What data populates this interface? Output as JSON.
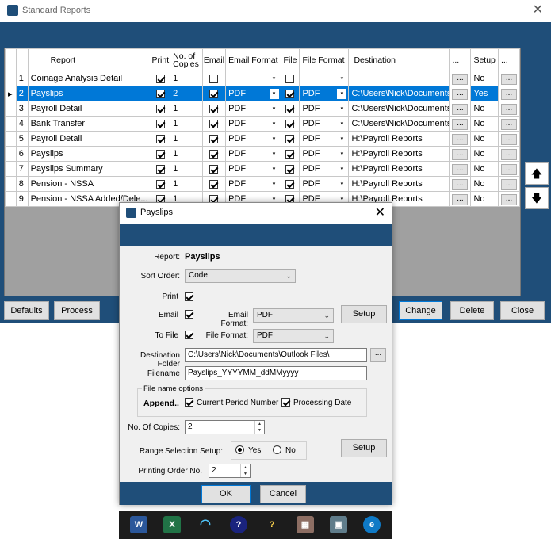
{
  "window": {
    "title": "Standard Reports",
    "close": "✕"
  },
  "grid": {
    "headers": {
      "report": "Report",
      "print": "Print",
      "copies": "No. of Copies",
      "email": "Email",
      "email_format": "Email Format",
      "file": "File",
      "file_format": "File Format",
      "destination": "Destination",
      "dots": "...",
      "setup": "Setup",
      "dots2": "..."
    },
    "rows": [
      {
        "n": "1",
        "report": "Coinage Analysis Detail",
        "print": true,
        "copies": "1",
        "email": false,
        "email_format": "",
        "file": false,
        "file_format": "",
        "destination": "",
        "setup": "No"
      },
      {
        "n": "2",
        "report": "Payslips",
        "print": true,
        "copies": "2",
        "email": true,
        "email_format": "PDF",
        "file": true,
        "file_format": "PDF",
        "destination": "C:\\Users\\Nick\\Documents\\...",
        "setup": "Yes"
      },
      {
        "n": "3",
        "report": "Payroll Detail",
        "print": true,
        "copies": "1",
        "email": true,
        "email_format": "PDF",
        "file": true,
        "file_format": "PDF",
        "destination": "C:\\Users\\Nick\\Documents\\...",
        "setup": "No"
      },
      {
        "n": "4",
        "report": "Bank Transfer",
        "print": true,
        "copies": "1",
        "email": true,
        "email_format": "PDF",
        "file": true,
        "file_format": "PDF",
        "destination": "C:\\Users\\Nick\\Documents\\...",
        "setup": "No"
      },
      {
        "n": "5",
        "report": "Payroll Detail",
        "print": true,
        "copies": "1",
        "email": true,
        "email_format": "PDF",
        "file": true,
        "file_format": "PDF",
        "destination": "H:\\Payroll Reports",
        "setup": "No"
      },
      {
        "n": "6",
        "report": "Payslips",
        "print": true,
        "copies": "1",
        "email": true,
        "email_format": "PDF",
        "file": true,
        "file_format": "PDF",
        "destination": "H:\\Payroll Reports",
        "setup": "No"
      },
      {
        "n": "7",
        "report": "Payslips Summary",
        "print": true,
        "copies": "1",
        "email": true,
        "email_format": "PDF",
        "file": true,
        "file_format": "PDF",
        "destination": "H:\\Payroll Reports",
        "setup": "No"
      },
      {
        "n": "8",
        "report": "Pension - NSSA",
        "print": true,
        "copies": "1",
        "email": true,
        "email_format": "PDF",
        "file": true,
        "file_format": "PDF",
        "destination": "H:\\Payroll Reports",
        "setup": "No"
      },
      {
        "n": "9",
        "report": "Pension - NSSA Added/Dele...",
        "print": true,
        "copies": "1",
        "email": true,
        "email_format": "PDF",
        "file": true,
        "file_format": "PDF",
        "destination": "H:\\Payroll Reports",
        "setup": "No"
      }
    ],
    "row_indicator": "▸",
    "dropdown_glyph": "▾",
    "dots_label": "..."
  },
  "side": {
    "up": "🡅",
    "down": "🡇"
  },
  "bottom_buttons": {
    "defaults": "Defaults",
    "process": "Process",
    "change": "Change",
    "delete": "Delete",
    "close": "Close"
  },
  "dialog": {
    "title": "Payslips",
    "close": "✕",
    "report_label": "Report:",
    "report_value": "Payslips",
    "sort_label": "Sort Order:",
    "sort_value": "Code",
    "print_label": "Print",
    "print_checked": true,
    "email_label": "Email",
    "email_checked": true,
    "email_format_label": "Email Format:",
    "email_format_value": "PDF",
    "setup_button": "Setup",
    "tofile_label": "To File",
    "tofile_checked": true,
    "file_format_label": "File Format:",
    "file_format_value": "PDF",
    "dest_label": "Destination Folder",
    "dest_value": "C:\\Users\\Nick\\Documents\\Outlook Files\\",
    "browse": "...",
    "filename_label": "Filename",
    "filename_value": "Payslips_YYYYMM_ddMMyyyy",
    "fno_title": "File name options",
    "append_label": "Append..",
    "current_period_label": "Current Period Number",
    "current_period_checked": true,
    "processing_date_label": "Processing Date",
    "processing_date_checked": true,
    "copies_label": "No. Of Copies:",
    "copies_value": "2",
    "range_label": "Range Selection Setup:",
    "range_yes": "Yes",
    "range_no": "No",
    "range_selected": "Yes",
    "setup_button2": "Setup",
    "order_label": "Printing Order No.",
    "order_value": "2",
    "ok": "OK",
    "cancel": "Cancel"
  },
  "taskbar": {
    "icons": [
      "word-icon",
      "excel-icon",
      "wifi-icon",
      "help-icon",
      "lock-icon",
      "archive-icon",
      "app-icon",
      "edge-icon"
    ]
  }
}
